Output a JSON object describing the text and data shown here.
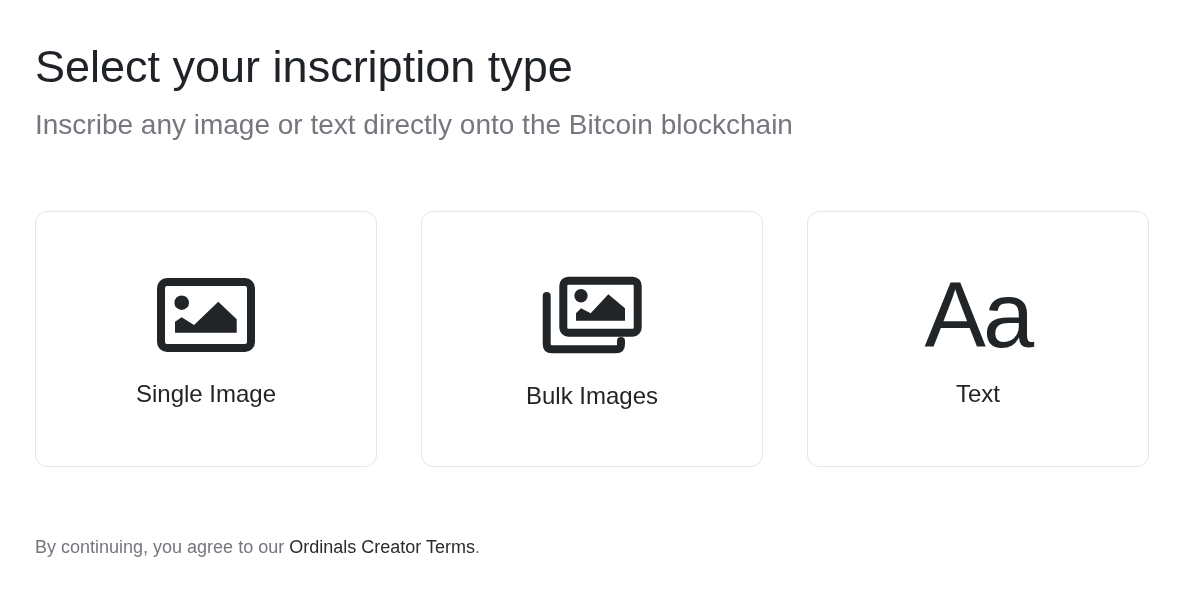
{
  "heading": "Select your inscription type",
  "subtitle": "Inscribe any image or text directly onto the Bitcoin blockchain",
  "options": [
    {
      "kind": "single_image",
      "label": "Single Image"
    },
    {
      "kind": "bulk_images",
      "label": "Bulk Images"
    },
    {
      "kind": "text",
      "glyph": "Aa",
      "label": "Text"
    }
  ],
  "footer": {
    "text": "By continuing, you agree to our ",
    "link": "Ordinals Creator Terms",
    "after": "."
  }
}
